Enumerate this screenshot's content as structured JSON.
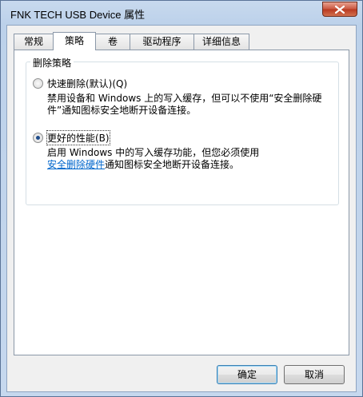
{
  "window": {
    "title": "FNK TECH USB Device 属性"
  },
  "tabs": [
    {
      "label": "常规"
    },
    {
      "label": "策略"
    },
    {
      "label": "卷"
    },
    {
      "label": "驱动程序"
    },
    {
      "label": "详细信息"
    }
  ],
  "active_tab": "策略",
  "policy": {
    "group_title": "删除策略",
    "option_quick": {
      "label": "快速删除(默认)(Q)",
      "description": "禁用设备和 Windows 上的写入缓存，但可以不使用“安全删除硬件”通知图标安全地断开设备连接。",
      "checked": false
    },
    "option_performance": {
      "label": "更好的性能(B)",
      "description_before": "启用 Windows 中的写入缓存功能，但您必须使用",
      "link": "安全删除硬件",
      "description_after": "通知图标安全地断开设备连接。",
      "checked": true
    }
  },
  "buttons": {
    "ok": "确定",
    "cancel": "取消"
  }
}
